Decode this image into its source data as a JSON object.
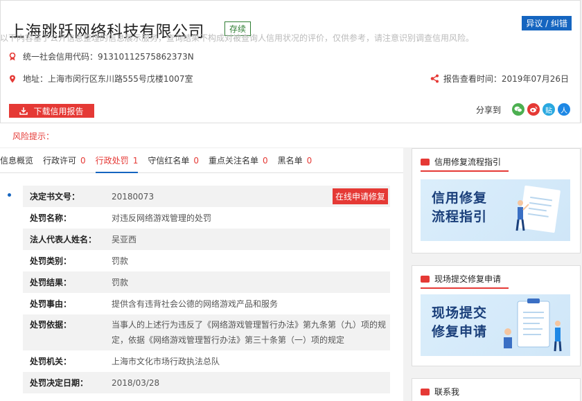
{
  "company": {
    "name": "上海跳跃网络科技有限公司",
    "status": "存续",
    "report_error": "异议 / 纠错",
    "credit_code_label": "统一社会信用代码：",
    "credit_code": "91310112575862373N",
    "address_label": "地址：",
    "address": "上海市闵行区东川路555号戊楼1007室",
    "report_time_label": "报告查看时间：",
    "report_time": "2019年07月26日"
  },
  "actions": {
    "download": "下载信用报告",
    "share_label": "分享到",
    "share_icons": [
      "wechat-icon",
      "weibo-icon",
      "tieba-icon",
      "renren-icon"
    ],
    "share_glyphs": [
      "",
      "",
      "贴",
      "人"
    ]
  },
  "risk": {
    "title": "风险提示：",
    "text": "以下内容基于公开信息整理的信息展示服务，查询结果不构成对被查询人信用状况的评价，仅供参考，请注意识别调查信用风险。"
  },
  "tabs": [
    {
      "label": "信息概览",
      "count": ""
    },
    {
      "label": "行政许可",
      "count": "0"
    },
    {
      "label": "行政处罚",
      "count": "1"
    },
    {
      "label": "守信红名单",
      "count": "0"
    },
    {
      "label": "重点关注名单",
      "count": "0"
    },
    {
      "label": "黑名单",
      "count": "0"
    }
  ],
  "penalty": {
    "repair_button": "在线申请修复",
    "rows": [
      {
        "label": "决定书文号：",
        "value": "20180073"
      },
      {
        "label": "处罚名称：",
        "value": "对违反网络游戏管理的处罚"
      },
      {
        "label": "法人代表人姓名：",
        "value": "吴亚西"
      },
      {
        "label": "处罚类别：",
        "value": "罚款"
      },
      {
        "label": "处罚结果：",
        "value": "罚款"
      },
      {
        "label": "处罚事由：",
        "value": "提供含有违背社会公德的网络游戏产品和服务"
      },
      {
        "label": "处罚依据：",
        "value": "当事人的上述行为违反了《网络游戏管理暂行办法》第九条第（九）项的规定，依据《网络游戏管理暂行办法》第三十条第（一）项的规定"
      },
      {
        "label": "处罚机关：",
        "value": "上海市文化市场行政执法总队"
      },
      {
        "label": "处罚决定日期：",
        "value": "2018/03/28"
      }
    ]
  },
  "sidebar": {
    "guide_title": "信用修复流程指引",
    "guide_banner": [
      "信用修复",
      "流程指引"
    ],
    "submit_title": "现场提交修复申请",
    "submit_banner": [
      "现场提交",
      "修复申请"
    ],
    "contact_title": "联系我"
  },
  "colors": {
    "accent": "#e53935",
    "blue": "#1565c0",
    "status_green": "#2e7d32"
  }
}
